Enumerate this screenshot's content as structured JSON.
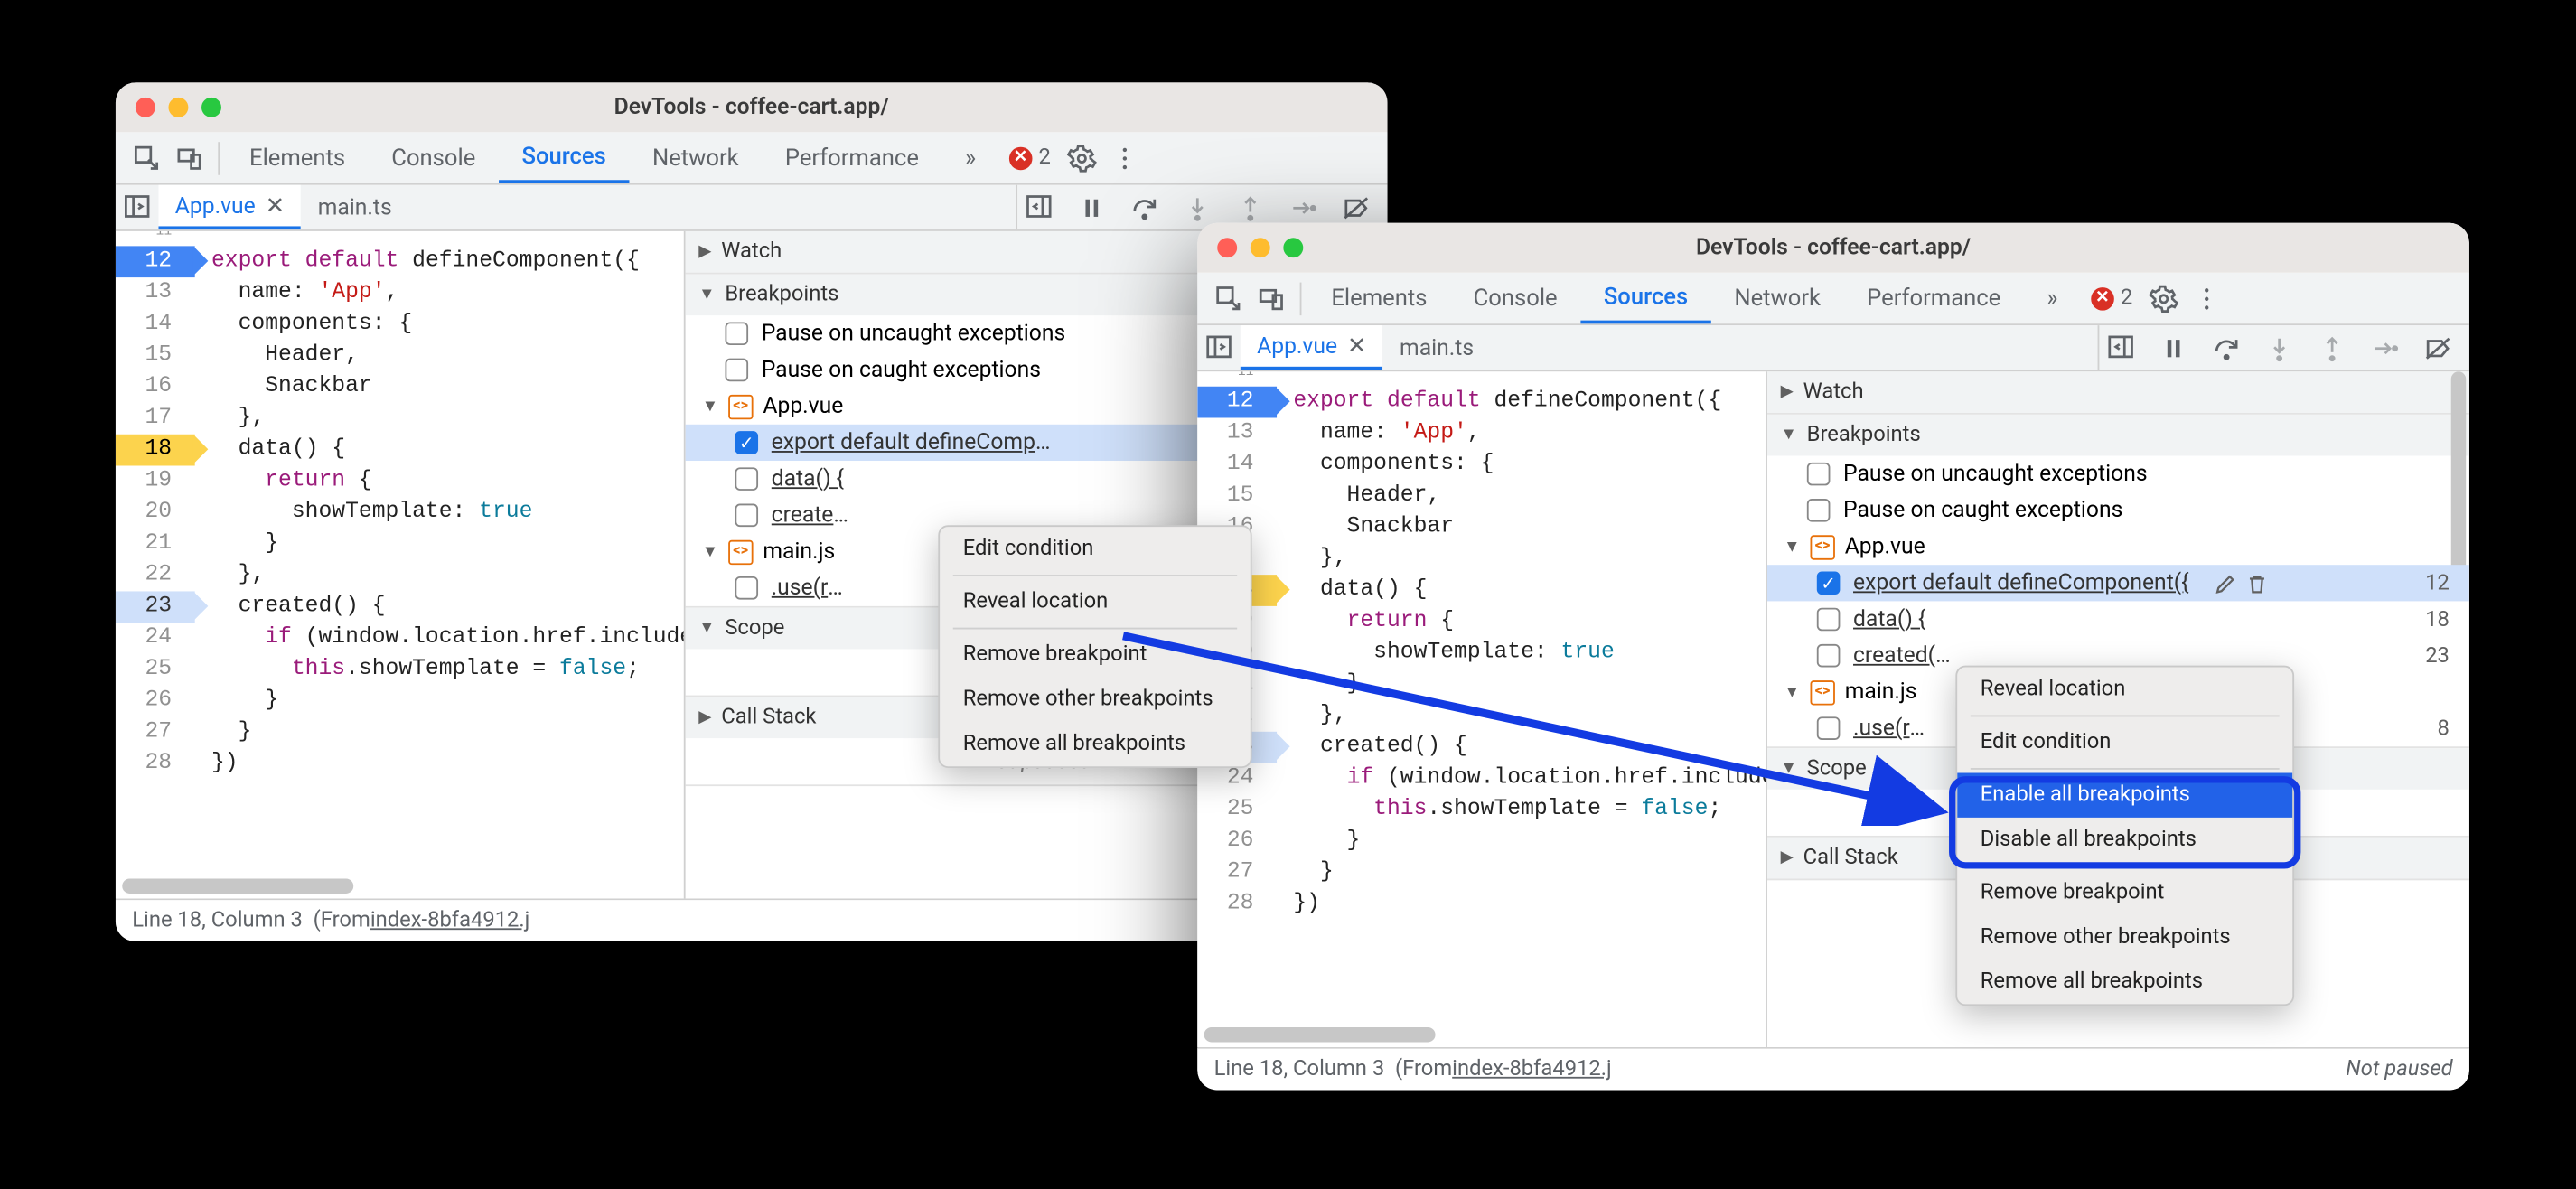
{
  "windows": {
    "title": "DevTools - coffee-cart.app/",
    "tabs": [
      "Elements",
      "Console",
      "Sources",
      "Network",
      "Performance"
    ],
    "activeTab": "Sources",
    "overflow": "»",
    "errorCount": "2",
    "fileTabs": {
      "active": "App.vue",
      "other": "main.ts"
    },
    "code": {
      "firstLineNo": 11,
      "lines": [
        "",
        "export default defineComponent({",
        "  name: 'App',",
        "  components: {",
        "    Header,",
        "    Snackbar",
        "  },",
        "  data() {",
        "    return {",
        "      showTemplate: true",
        "    }",
        "  },",
        "  created() {",
        "    if (window.location.href.includes('?breakable')) {",
        "      this.showTemplate = false;",
        "    }",
        "  }",
        "})"
      ],
      "bpActive": 12,
      "bpCond": 18,
      "bpLine": 23
    },
    "side": {
      "watch": "Watch",
      "breakpoints": "Breakpoints",
      "pauseUncaught": "Pause on uncaught exceptions",
      "pauseCaught": "Pause on caught exceptions",
      "appvue": "App.vue",
      "mainjs": "main.js",
      "bpExport": "export default defineComponent({",
      "bpData": "data() {",
      "bpCreated": "created() {",
      "bpUse": ".use(router)",
      "ln12": "12",
      "ln18": "18",
      "ln23": "23",
      "ln8": "8",
      "scope": "Scope",
      "callstack": "Call Stack",
      "notPaused": "Not paused"
    },
    "status": {
      "pos": "Line 18, Column 3",
      "from": "(From ",
      "file": "index-8bfa4912.j",
      "np": "Not paused"
    },
    "ctx1": {
      "editCond": "Edit condition",
      "reveal": "Reveal location",
      "remove": "Remove breakpoint",
      "removeOther": "Remove other breakpoints",
      "removeAll": "Remove all breakpoints"
    },
    "ctx2": {
      "reveal": "Reveal location",
      "editCond": "Edit condition",
      "enableAll": "Enable all breakpoints",
      "disableAll": "Disable all breakpoints",
      "remove": "Remove breakpoint",
      "removeOther": "Remove other breakpoints",
      "removeAll": "Remove all breakpoints"
    }
  }
}
